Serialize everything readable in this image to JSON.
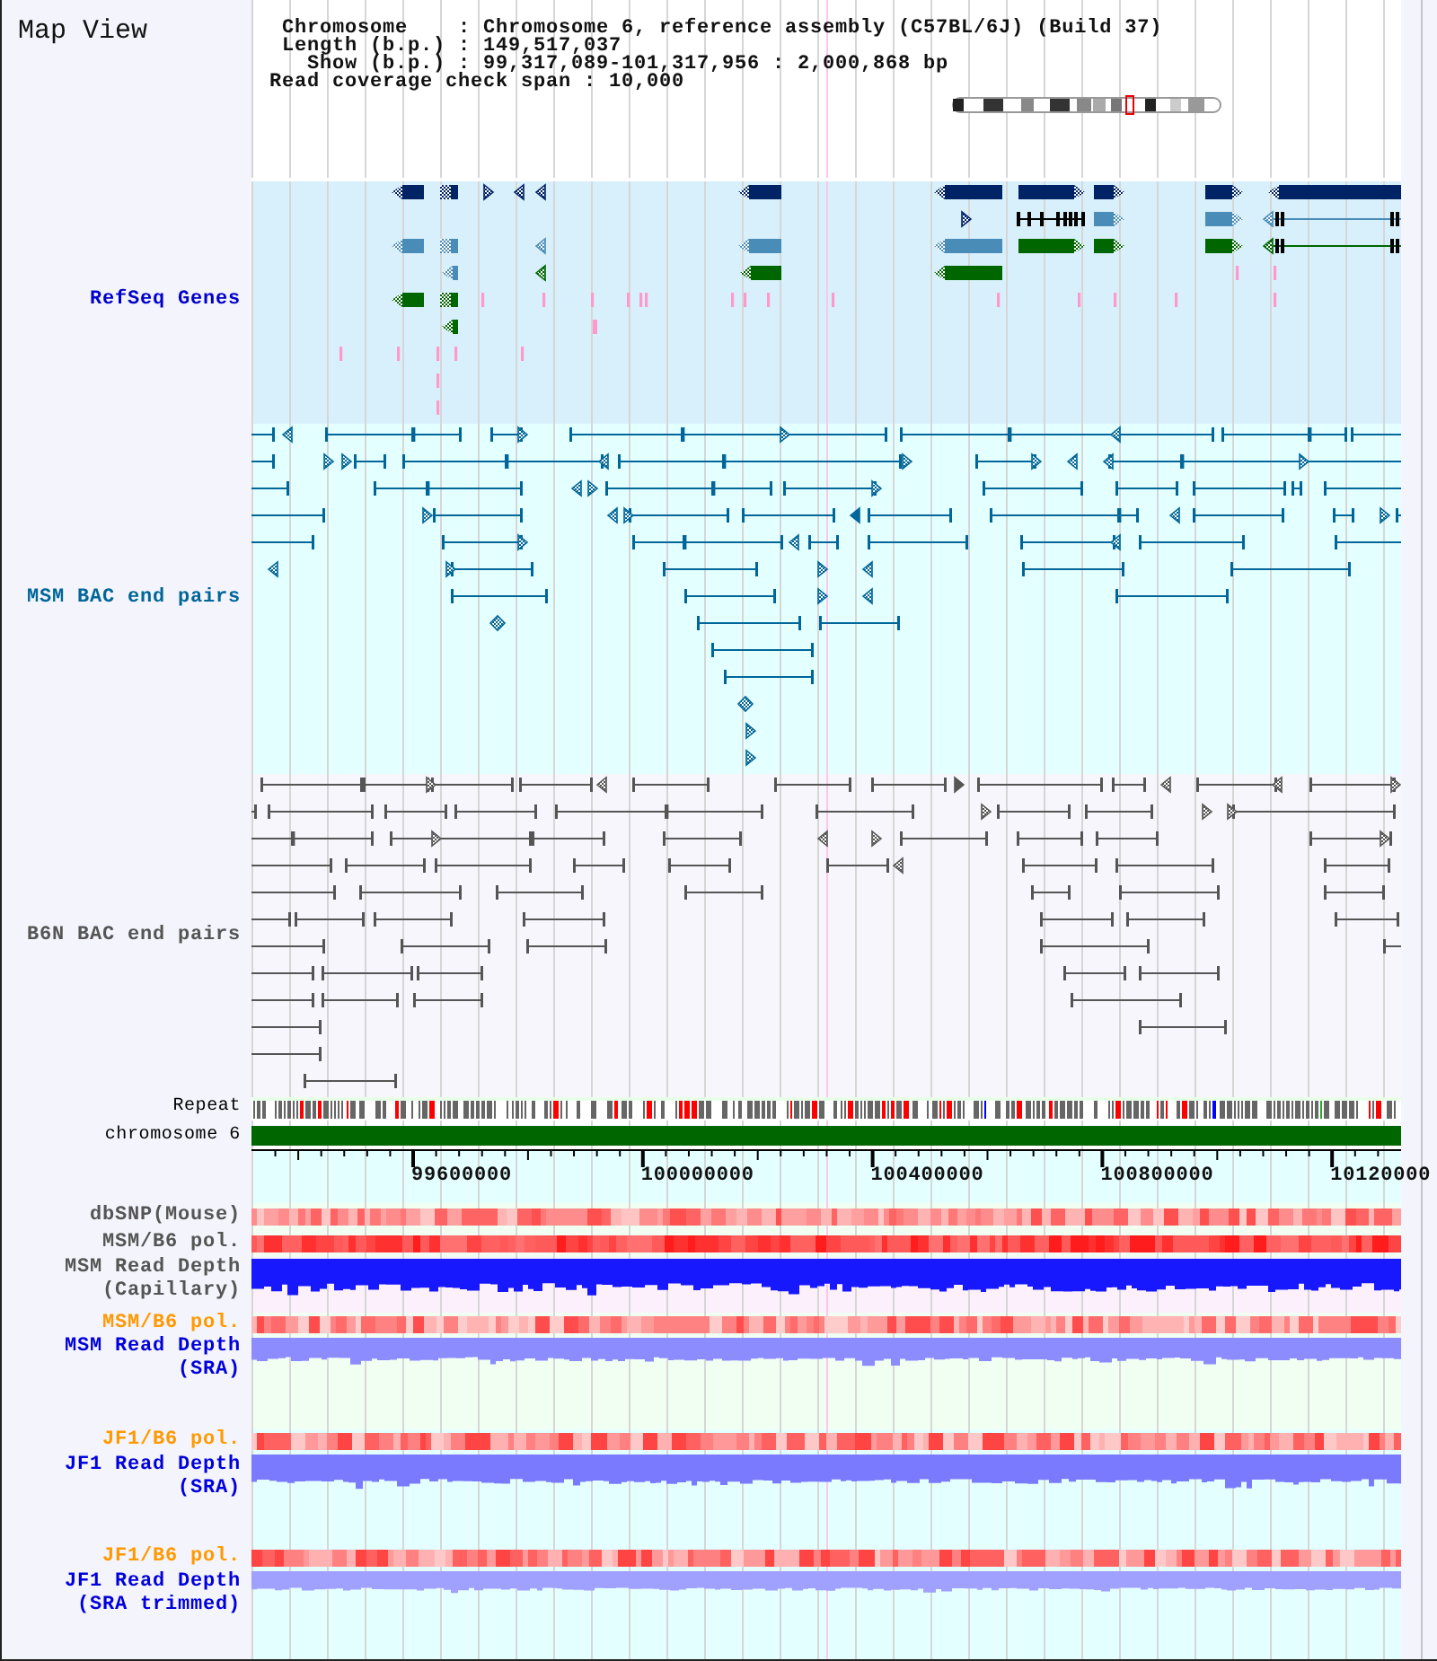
{
  "title": "Map View",
  "info": [
    "Chromosome    : Chromosome 6, reference assembly (C57BL/6J) (Build 37)",
    "Length (b.p.) : 149,517,037",
    "Show (b.p.) : 99,317,089-101,317,956 : 2,000,868 bp",
    "Read coverage check span : 10,000"
  ],
  "tracks": [
    {
      "kind": "genes",
      "label": "RefSeq Genes",
      "color": "#0000cc"
    },
    {
      "kind": "pairs",
      "label": "MSM BAC end pairs",
      "color": "#006699"
    },
    {
      "kind": "pairs",
      "label": "B6N BAC end pairs",
      "color": "#555555"
    },
    {
      "kind": "repeat",
      "label": "Repeat",
      "color": "#000000"
    },
    {
      "kind": "chromosome",
      "label": "chromosome 6",
      "color": "#000000"
    },
    {
      "kind": "axis",
      "ticks": [
        "99600000",
        "100000000",
        "100400000",
        "100800000",
        "10120000"
      ]
    },
    {
      "kind": "polymorphism",
      "label": "dbSNP(Mouse)",
      "color": "#555555"
    },
    {
      "kind": "polymorphism",
      "label": "MSM/B6 pol.",
      "color": "#555555"
    },
    {
      "kind": "depth",
      "label": "MSM Read Depth (Capillary)",
      "color": "#555555"
    },
    {
      "kind": "polymorphism",
      "label": "MSM/B6 pol.",
      "color": "#ff9900"
    },
    {
      "kind": "depth",
      "label": "MSM Read Depth (SRA)",
      "color": "#0000dd"
    },
    {
      "kind": "polymorphism",
      "label": "JF1/B6 pol.",
      "color": "#ff9900"
    },
    {
      "kind": "depth",
      "label": "JF1 Read Depth (SRA)",
      "color": "#0000dd"
    },
    {
      "kind": "polymorphism",
      "label": "JF1/B6 pol.",
      "color": "#ff9900"
    },
    {
      "kind": "depth",
      "label": "JF1 Read Depth (SRA trimmed)",
      "color": "#0000dd"
    }
  ]
}
